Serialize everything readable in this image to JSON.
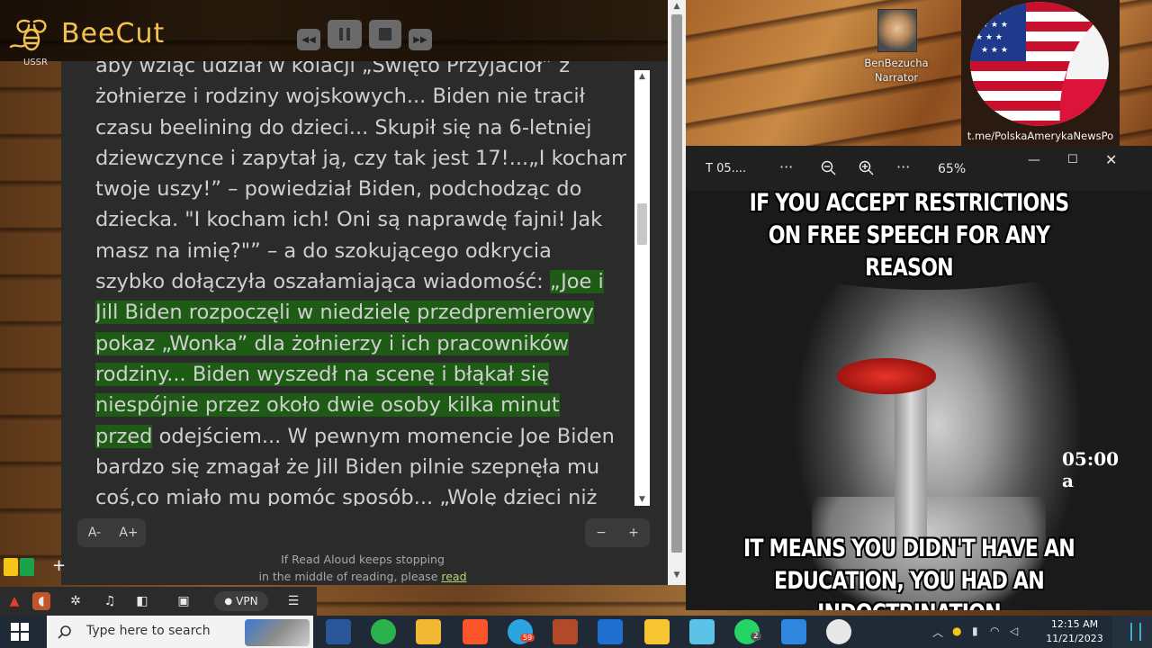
{
  "beecut": {
    "name": "BeeCut"
  },
  "desktop": {
    "partial_label": "USSR"
  },
  "reader": {
    "lines": [
      {
        "text": "aby wziąć udział w kolacji „Święto Przyjaciół” z",
        "hl": false,
        "cls": "first"
      },
      {
        "text": "żołnierze i rodziny wojskowych... Biden nie tracił",
        "hl": false
      },
      {
        "text": "czasu beelining do dzieci... Skupił się na 6-letniej",
        "hl": false
      },
      {
        "text": "dziewczynce i zapytał ją, czy tak jest 17!...„I kocham",
        "hl": false
      },
      {
        "text": "twoje uszy!” – powiedział Biden, podchodząc do",
        "hl": false
      },
      {
        "text": "dziecka. \"I kocham ich! Oni są naprawdę fajni! Jak",
        "hl": false
      },
      {
        "text": "masz na imię?\"” – a do szokującego odkrycia",
        "hl": false
      },
      {
        "text": "szybko dołączyła oszałamiająca wiadomość: ",
        "hl_tail": "„Joe i"
      },
      {
        "text": "Jill Biden rozpoczęli w niedzielę przedpremierowy",
        "hl": true
      },
      {
        "text": "pokaz „Wonka” dla żołnierzy i ich pracowników",
        "hl": true
      },
      {
        "text": "rodziny... Biden wyszedł na scenę i błąkał się",
        "hl": true
      },
      {
        "text": "niespójnie przez około dwie osoby kilka minut",
        "hl": true
      },
      {
        "hl_head": "przed",
        "text": " odejściem... W pewnym momencie Joe Biden"
      },
      {
        "text": "bardzo się zmagał że Jill Biden pilnie szepnęła mu",
        "hl": false
      },
      {
        "text": "coś,co miało mu pomóc sposób... „Wolę dzieci niż",
        "hl": false
      }
    ],
    "font_decrease": "A-",
    "font_increase": "A+",
    "zoom_minus": "−",
    "zoom_plus": "+",
    "note_line1": "If Read Aloud keeps stopping",
    "note_line2": "in the middle of reading, please ",
    "note_link": "read"
  },
  "narrator": {
    "name": "BenBezucha",
    "role": "Narrator"
  },
  "flag_logo": {
    "link": "t.me/PolskaAmerykaNewsPo"
  },
  "viewer": {
    "title": "T 05....",
    "zoom": "65%",
    "meme_top": "IF YOU ACCEPT RESTRICTIONS\nON FREE SPEECH FOR ANY REASON",
    "meme_bottom": "IT MEANS YOU DIDN'T HAVE AN\nEDUCATION, YOU HAD AN INDOCTRINATION",
    "time_overlay": "05:00 a"
  },
  "ext_bar": {
    "vpn_label": "VPN"
  },
  "taskbar": {
    "search_placeholder": "Type here to search",
    "time": "12:15 AM",
    "date": "11/21/2023",
    "telegram_badge": "59",
    "whatsapp_badge": "2"
  },
  "colors": {
    "highlight": "#1e5c16",
    "beecut_gold": "#f2c14e",
    "taskbar": "#1f2a36"
  }
}
